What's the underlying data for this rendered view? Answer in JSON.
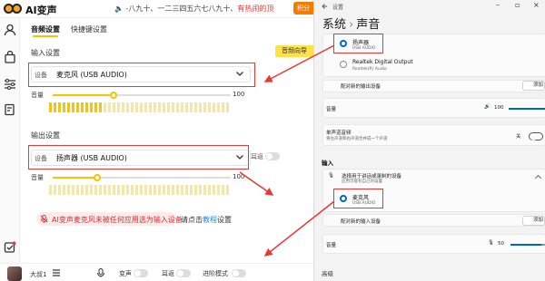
{
  "app": {
    "title": "AI变声",
    "marquee_text": "-八九十、一二三四五六七八九十、",
    "marquee_highlight": "有热闹的顶",
    "points_label": "积分"
  },
  "sidebar_icons": [
    "user-icon",
    "bag-icon",
    "sliders-icon",
    "edit-icon",
    "badge-icon"
  ],
  "tabs": [
    {
      "label": "音频设置",
      "active": true
    },
    {
      "label": "快捷键设置",
      "active": false
    }
  ],
  "input_section": {
    "title": "输入设置",
    "guide_button": "音频向导",
    "device_label": "设备",
    "device_value": "麦克风 (USB AUDIO)",
    "volume_label": "音量",
    "volume_value": "100",
    "volume_fraction": 0.34,
    "meter_on": 12,
    "meter_total": 40
  },
  "output_section": {
    "title": "输出设置",
    "device_label": "设备",
    "device_value": "扬声器 (USB AUDIO)",
    "monitor_label": "耳返",
    "volume_label": "音量",
    "volume_value": "100",
    "volume_fraction": 0.25,
    "meter_on": 0,
    "meter_total": 40
  },
  "warning": {
    "text": "AI变声麦克风未被任何应用选为输入设备",
    "after_prefix": "请点击",
    "link": "教程",
    "after_suffix": "设置"
  },
  "footer": {
    "username": "大叔1",
    "items": [
      {
        "label": "变声",
        "icon": "mic-icon"
      },
      {
        "label": "耳返",
        "icon": "headphone-icon"
      },
      {
        "label": "进阶模式",
        "icon": "advanced-icon"
      }
    ]
  },
  "windows_settings": {
    "window_title": "设置",
    "breadcrumb_parent": "系统",
    "breadcrumb_current": "声音",
    "output_devices": [
      {
        "name": "扬声器",
        "sub": "USB AUDIO",
        "selected": true
      },
      {
        "name": "Realtek Digital Output",
        "sub": "Realtek(R) Audio",
        "selected": false
      }
    ],
    "pair_output": "配对新的输出设备",
    "add_device": "添加",
    "volume_label": "音量",
    "output_volume": "100",
    "mono_title": "单声道音频",
    "mono_sub": "将左声道和右声道合并成一个声道",
    "mono_state": "关",
    "input_heading": "输入",
    "choose_input": "选择用于讲话或录制的设备",
    "choose_input_sub": "应用可能有自己的设置",
    "input_devices": [
      {
        "name": "麦克风",
        "sub": "USB AUDIO",
        "selected": true
      }
    ],
    "pair_input": "配对新的输入设备",
    "input_volume": "50",
    "advanced": "高级"
  }
}
